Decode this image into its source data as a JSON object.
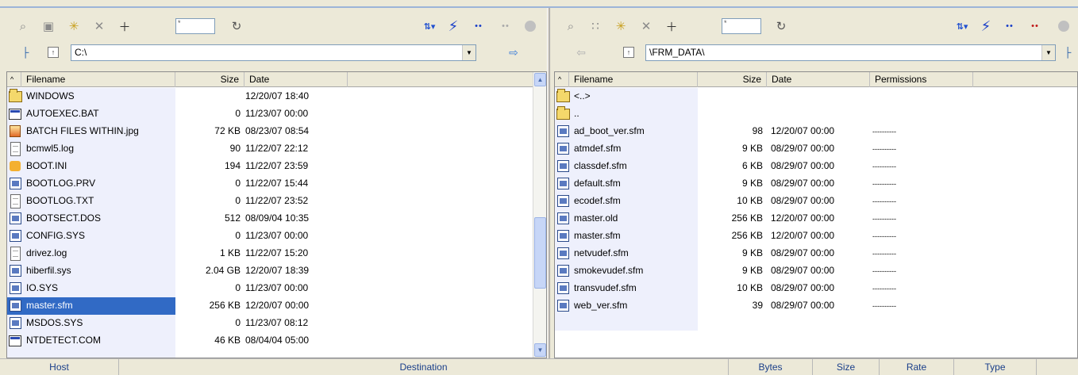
{
  "left": {
    "filter_value": "*",
    "path": "C:\\",
    "columns": {
      "filename": "Filename",
      "size": "Size",
      "date": "Date"
    },
    "files": [
      {
        "name": "WINDOWS",
        "size": "",
        "date": "12/20/07 18:40",
        "icon": "folder-icon"
      },
      {
        "name": "AUTOEXEC.BAT",
        "size": "0",
        "date": "11/23/07 00:00",
        "icon": "batch-file-icon"
      },
      {
        "name": "BATCH FILES WITHIN.jpg",
        "size": "72 KB",
        "date": "08/23/07 08:54",
        "icon": "image-file-icon"
      },
      {
        "name": "bcmwl5.log",
        "size": "90",
        "date": "11/22/07 22:12",
        "icon": "text-file-icon"
      },
      {
        "name": "BOOT.INI",
        "size": "194",
        "date": "11/22/07 23:59",
        "icon": "config-file-icon"
      },
      {
        "name": "BOOTLOG.PRV",
        "size": "0",
        "date": "11/22/07 15:44",
        "icon": "system-file-icon"
      },
      {
        "name": "BOOTLOG.TXT",
        "size": "0",
        "date": "11/22/07 23:52",
        "icon": "text-file-icon"
      },
      {
        "name": "BOOTSECT.DOS",
        "size": "512",
        "date": "08/09/04 10:35",
        "icon": "system-file-icon"
      },
      {
        "name": "CONFIG.SYS",
        "size": "0",
        "date": "11/23/07 00:00",
        "icon": "system-file-icon"
      },
      {
        "name": "drivez.log",
        "size": "1 KB",
        "date": "11/22/07 15:20",
        "icon": "text-file-icon"
      },
      {
        "name": "hiberfil.sys",
        "size": "2.04 GB",
        "date": "12/20/07 18:39",
        "icon": "system-file-icon"
      },
      {
        "name": "IO.SYS",
        "size": "0",
        "date": "11/23/07 00:00",
        "icon": "system-file-icon"
      },
      {
        "name": "master.sfm",
        "size": "256 KB",
        "date": "12/20/07 00:00",
        "icon": "sfm-file-icon",
        "selected": true
      },
      {
        "name": "MSDOS.SYS",
        "size": "0",
        "date": "11/23/07 08:12",
        "icon": "system-file-icon"
      },
      {
        "name": "NTDETECT.COM",
        "size": "46 KB",
        "date": "08/04/04 05:00",
        "icon": "batch-file-icon"
      }
    ]
  },
  "right": {
    "filter_value": "*",
    "path": "\\FRM_DATA\\",
    "columns": {
      "filename": "Filename",
      "size": "Size",
      "date": "Date",
      "permissions": "Permissions"
    },
    "files": [
      {
        "name": "<..>",
        "size": "",
        "date": "",
        "perm": "",
        "icon": "folder-icon"
      },
      {
        "name": "..",
        "size": "",
        "date": "",
        "perm": "",
        "icon": "folder-icon"
      },
      {
        "name": "ad_boot_ver.sfm",
        "size": "98",
        "date": "12/20/07 00:00",
        "perm": "----------",
        "icon": "sfm-file-icon"
      },
      {
        "name": "atmdef.sfm",
        "size": "9 KB",
        "date": "08/29/07 00:00",
        "perm": "----------",
        "icon": "sfm-file-icon"
      },
      {
        "name": "classdef.sfm",
        "size": "6 KB",
        "date": "08/29/07 00:00",
        "perm": "----------",
        "icon": "sfm-file-icon"
      },
      {
        "name": "default.sfm",
        "size": "9 KB",
        "date": "08/29/07 00:00",
        "perm": "----------",
        "icon": "sfm-file-icon"
      },
      {
        "name": "ecodef.sfm",
        "size": "10 KB",
        "date": "08/29/07 00:00",
        "perm": "----------",
        "icon": "sfm-file-icon"
      },
      {
        "name": "master.old",
        "size": "256 KB",
        "date": "12/20/07 00:00",
        "perm": "----------",
        "icon": "sfm-file-icon"
      },
      {
        "name": "master.sfm",
        "size": "256 KB",
        "date": "12/20/07 00:00",
        "perm": "----------",
        "icon": "sfm-file-icon"
      },
      {
        "name": "netvudef.sfm",
        "size": "9 KB",
        "date": "08/29/07 00:00",
        "perm": "----------",
        "icon": "sfm-file-icon"
      },
      {
        "name": "smokevudef.sfm",
        "size": "9 KB",
        "date": "08/29/07 00:00",
        "perm": "----------",
        "icon": "sfm-file-icon"
      },
      {
        "name": "transvudef.sfm",
        "size": "10 KB",
        "date": "08/29/07 00:00",
        "perm": "----------",
        "icon": "sfm-file-icon"
      },
      {
        "name": "web_ver.sfm",
        "size": "39",
        "date": "08/29/07 00:00",
        "perm": "----------",
        "icon": "sfm-file-icon"
      }
    ]
  },
  "status": {
    "host": "Host",
    "destination": "Destination",
    "bytes": "Bytes",
    "size": "Size",
    "rate": "Rate",
    "type": "Type"
  },
  "colors": {
    "selection": "#316ac5",
    "name_column_bg": "#eef0fc",
    "accent": "#1a3fc8"
  }
}
